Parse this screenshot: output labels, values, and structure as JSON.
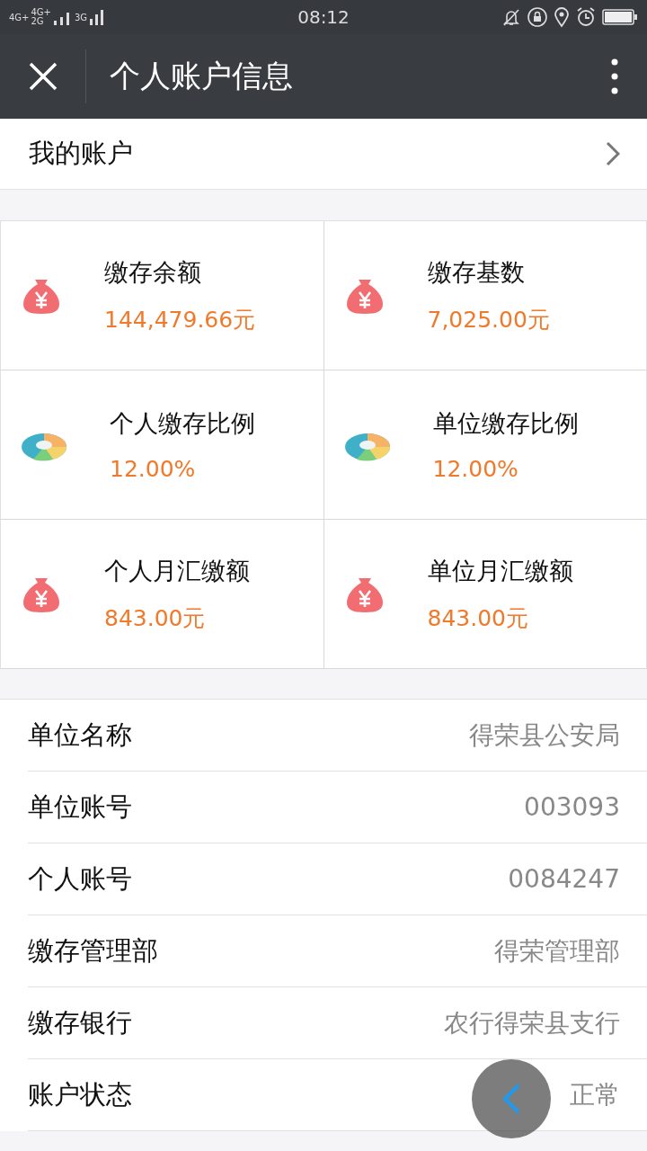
{
  "status_bar": {
    "network_labels": [
      "4G+",
      "4G+",
      "2G",
      "3G"
    ],
    "time": "08:12"
  },
  "header": {
    "title": "个人账户信息"
  },
  "my_account": {
    "label": "我的账户"
  },
  "stats": [
    {
      "kind": "amount",
      "label": "缴存余额",
      "value": "144,479.66元"
    },
    {
      "kind": "amount",
      "label": "缴存基数",
      "value": "7,025.00元"
    },
    {
      "kind": "ratio",
      "label": "个人缴存比例",
      "value": "12.00%"
    },
    {
      "kind": "ratio",
      "label": "单位缴存比例",
      "value": "12.00%"
    },
    {
      "kind": "amount",
      "label": "个人月汇缴额",
      "value": "843.00元"
    },
    {
      "kind": "amount",
      "label": "单位月汇缴额",
      "value": "843.00元"
    }
  ],
  "details": [
    {
      "label": "单位名称",
      "value": "得荣县公安局"
    },
    {
      "label": "单位账号",
      "value": "003093"
    },
    {
      "label": "个人账号",
      "value": "0084247"
    },
    {
      "label": "缴存管理部",
      "value": "得荣管理部"
    },
    {
      "label": "缴存银行",
      "value": "农行得荣县支行"
    },
    {
      "label": "账户状态",
      "value": "正常"
    }
  ]
}
